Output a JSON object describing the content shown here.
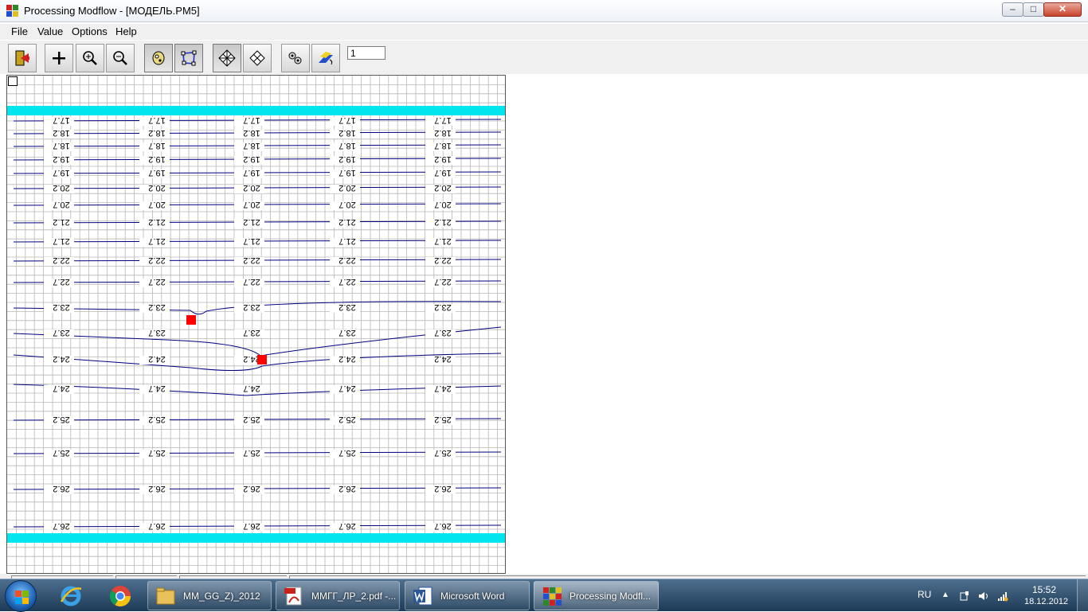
{
  "window": {
    "title": "Processing Modflow - [МОДЕЛЬ.PM5]",
    "min_symbol": "–",
    "max_symbol": "□",
    "close_symbol": "✕"
  },
  "menu": [
    "File",
    "Value",
    "Options",
    "Help"
  ],
  "toolbar": {
    "layer_value": "1",
    "tools": [
      "exit-tool",
      "add-tool",
      "zoom-in-tool",
      "zoom-out-tool",
      "cell-value-tool",
      "polygon-tool",
      "grid-tool",
      "mesh-tool",
      "settings-tool",
      "paint-tool"
    ]
  },
  "map": {
    "contour_labels": [
      "17.7",
      "18.2",
      "18.7",
      "19.2",
      "19.7",
      "20.2",
      "20.7",
      "21.2",
      "21.7",
      "22.2",
      "22.7",
      "23.2",
      "23.7",
      "24.2",
      "24.7",
      "25.2",
      "25.7",
      "26.2",
      "26.7"
    ],
    "colors": {
      "boundary": "#00e5ee",
      "well": "#ff0000",
      "contour": "#000080",
      "grid": "#b8b8b8"
    }
  },
  "taskbar": {
    "tasks": [
      {
        "label": "MM_GG_Z)_2012",
        "icon": "folder-icon"
      },
      {
        "label": "ММГГ_ЛР_2.pdf -...",
        "icon": "pdf-icon"
      },
      {
        "label": "Microsoft Word",
        "icon": "word-icon"
      },
      {
        "label": "Processing Modfl...",
        "icon": "modflow-icon"
      }
    ],
    "language": "RU",
    "time": "15:52",
    "date": "18.12.2012"
  }
}
